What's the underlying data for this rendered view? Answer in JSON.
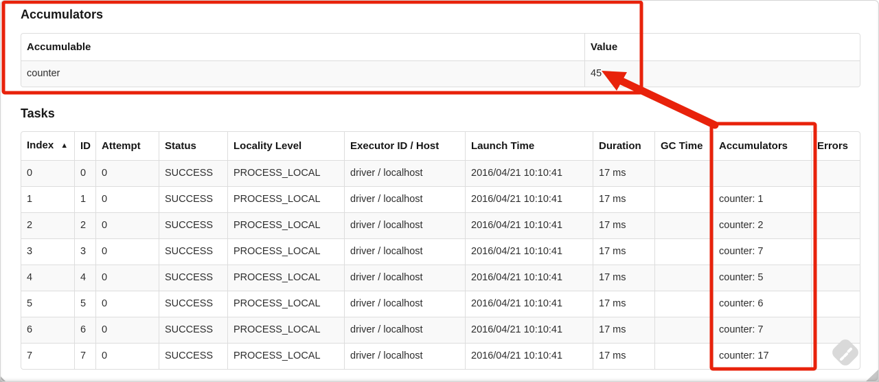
{
  "page": {
    "accumulators": {
      "title": "Accumulators",
      "headers": [
        "Accumulable",
        "Value"
      ],
      "rows": [
        [
          "counter",
          "45"
        ]
      ]
    },
    "tasks": {
      "title": "Tasks",
      "columns": [
        {
          "label": "Index",
          "sort_indicator": "▲"
        },
        {
          "label": "ID"
        },
        {
          "label": "Attempt"
        },
        {
          "label": "Status"
        },
        {
          "label": "Locality Level"
        },
        {
          "label": "Executor ID / Host"
        },
        {
          "label": "Launch Time"
        },
        {
          "label": "Duration"
        },
        {
          "label": "GC Time"
        },
        {
          "label": "Accumulators"
        },
        {
          "label": "Errors"
        }
      ],
      "rows": [
        [
          "0",
          "0",
          "0",
          "SUCCESS",
          "PROCESS_LOCAL",
          "driver / localhost",
          "2016/04/21 10:10:41",
          "17 ms",
          "",
          "",
          ""
        ],
        [
          "1",
          "1",
          "0",
          "SUCCESS",
          "PROCESS_LOCAL",
          "driver / localhost",
          "2016/04/21 10:10:41",
          "17 ms",
          "",
          "counter: 1",
          ""
        ],
        [
          "2",
          "2",
          "0",
          "SUCCESS",
          "PROCESS_LOCAL",
          "driver / localhost",
          "2016/04/21 10:10:41",
          "17 ms",
          "",
          "counter: 2",
          ""
        ],
        [
          "3",
          "3",
          "0",
          "SUCCESS",
          "PROCESS_LOCAL",
          "driver / localhost",
          "2016/04/21 10:10:41",
          "17 ms",
          "",
          "counter: 7",
          ""
        ],
        [
          "4",
          "4",
          "0",
          "SUCCESS",
          "PROCESS_LOCAL",
          "driver / localhost",
          "2016/04/21 10:10:41",
          "17 ms",
          "",
          "counter: 5",
          ""
        ],
        [
          "5",
          "5",
          "0",
          "SUCCESS",
          "PROCESS_LOCAL",
          "driver / localhost",
          "2016/04/21 10:10:41",
          "17 ms",
          "",
          "counter: 6",
          ""
        ],
        [
          "6",
          "6",
          "0",
          "SUCCESS",
          "PROCESS_LOCAL",
          "driver / localhost",
          "2016/04/21 10:10:41",
          "17 ms",
          "",
          "counter: 7",
          ""
        ],
        [
          "7",
          "7",
          "0",
          "SUCCESS",
          "PROCESS_LOCAL",
          "driver / localhost",
          "2016/04/21 10:10:41",
          "17 ms",
          "",
          "counter: 17",
          ""
        ]
      ]
    },
    "annotations": {
      "color": "#e8220b"
    },
    "watermark": {
      "icon": "feedly",
      "color": "#d9d9d9"
    }
  }
}
